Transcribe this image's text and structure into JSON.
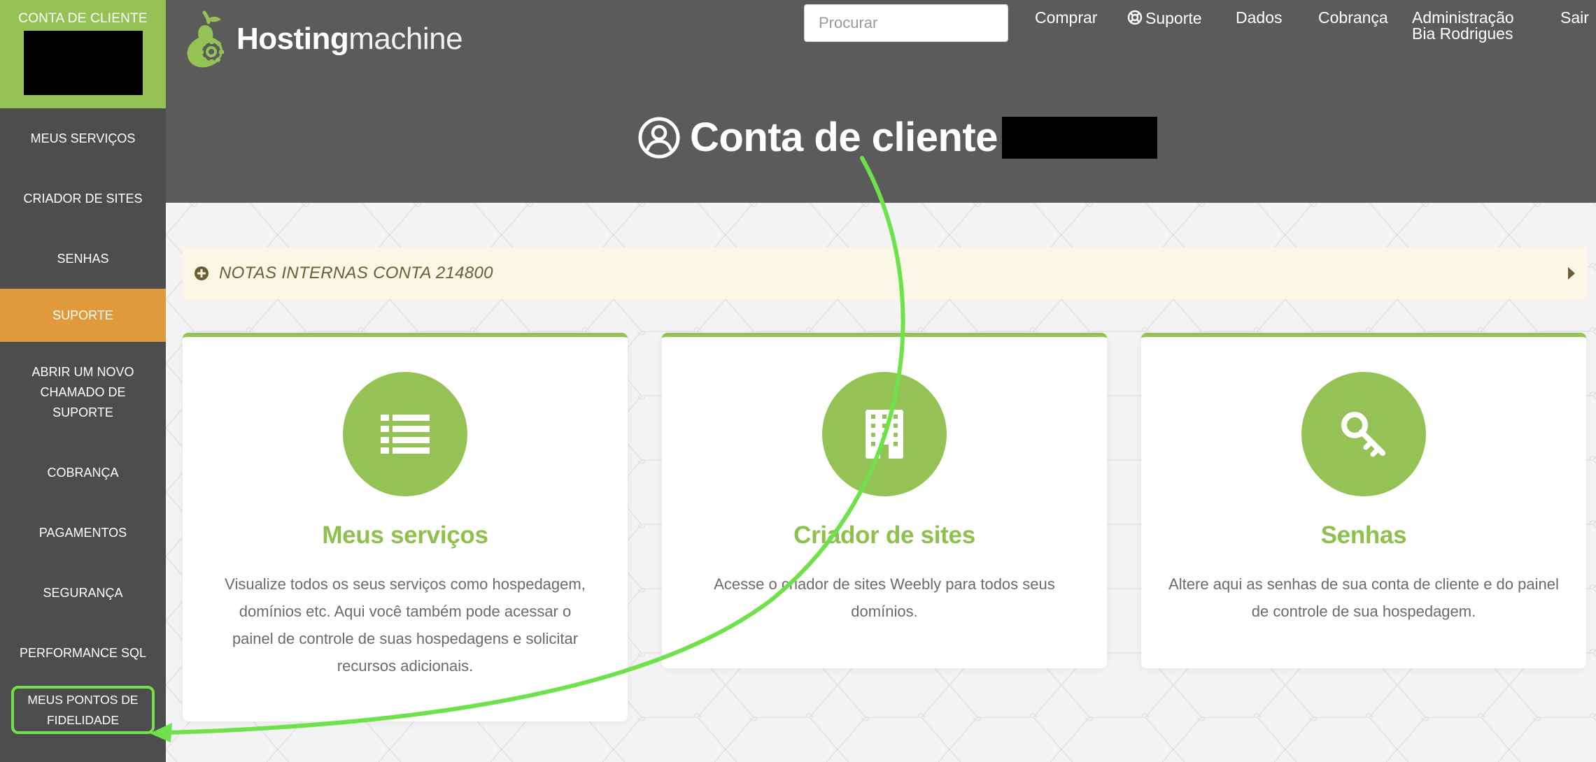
{
  "sidebar": {
    "account_label": "CONTA DE CLIENTE",
    "items": [
      {
        "label": "MEUS SERVIÇOS"
      },
      {
        "label": "CRIADOR DE SITES"
      },
      {
        "label": "SENHAS"
      },
      {
        "label": "SUPORTE",
        "active": true
      },
      {
        "label": "ABRIR UM NOVO CHAMADO DE SUPORTE"
      },
      {
        "label": "COBRANÇA"
      },
      {
        "label": "PAGAMENTOS"
      },
      {
        "label": "SEGURANÇA"
      },
      {
        "label": "PERFORMANCE SQL"
      },
      {
        "label": "MEUS PONTOS DE FIDELIDADE",
        "highlighted": true
      }
    ]
  },
  "header": {
    "logo": {
      "bold": "Hosting",
      "light": "machine"
    },
    "search": {
      "placeholder": "Procurar",
      "clear_icon": "close-icon"
    },
    "nav": {
      "buy": "Comprar",
      "support": "Suporte",
      "data": "Dados",
      "billing": "Cobrança",
      "admin": "Administração",
      "admin_user": "Bia Rodrigues",
      "logout": "Sair"
    },
    "title": "Conta de cliente"
  },
  "notes": {
    "label": "NOTAS INTERNAS CONTA 214800"
  },
  "cards": [
    {
      "icon": "list-icon",
      "title": "Meus serviços",
      "description": "Visualize todos os seus serviços como hospedagem, domínios etc. Aqui você também pode acessar o painel de controle de suas hospedagens e solicitar recursos adicionais."
    },
    {
      "icon": "building-icon",
      "title": "Criador de sites",
      "description": "Acesse o criador de sites Weebly para todos seus domínios."
    },
    {
      "icon": "key-icon",
      "title": "Senhas",
      "description": "Altere aqui as senhas de sua conta de cliente e do painel de controle de sua hospedagem."
    }
  ],
  "colors": {
    "sidebar_bg": "#4d4d4d",
    "header_bg": "#5b5b5b",
    "brand_green": "#94c255",
    "active_orange": "#e09a3c",
    "annotation_green": "#6fe24b",
    "notes_bg": "#fbf7e6"
  }
}
